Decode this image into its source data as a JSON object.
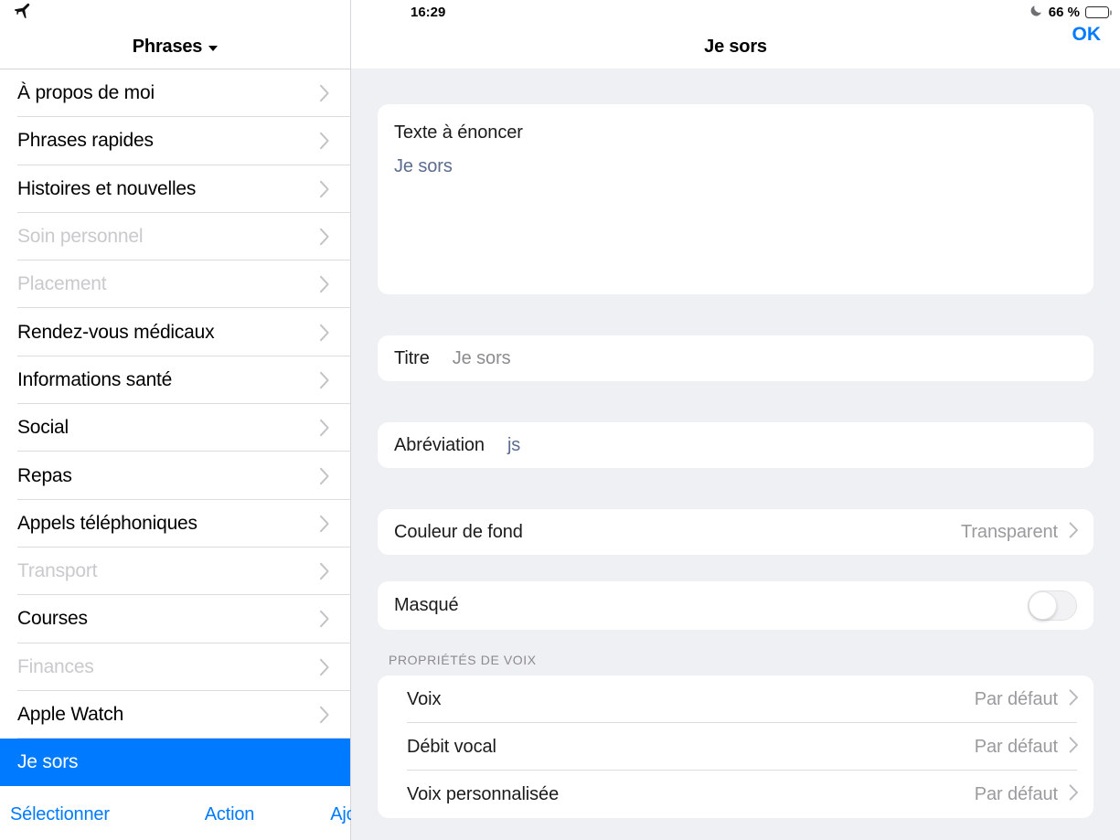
{
  "status_bar": {
    "airplane_icon": "airplane-mode-icon",
    "time": "16:29",
    "dnd_icon": "crescent-moon-icon",
    "battery_label": "66 %",
    "battery_percent": 66
  },
  "sidebar": {
    "header": {
      "title": "Phrases",
      "caret_icon": "chevron-down-icon"
    },
    "items": [
      {
        "label": "À propos de moi",
        "dimmed": false,
        "selected": false,
        "chevron": true
      },
      {
        "label": "Phrases rapides",
        "dimmed": false,
        "selected": false,
        "chevron": true
      },
      {
        "label": "Histoires et nouvelles",
        "dimmed": false,
        "selected": false,
        "chevron": true
      },
      {
        "label": "Soin personnel",
        "dimmed": true,
        "selected": false,
        "chevron": true
      },
      {
        "label": "Placement",
        "dimmed": true,
        "selected": false,
        "chevron": true
      },
      {
        "label": "Rendez-vous médicaux",
        "dimmed": false,
        "selected": false,
        "chevron": true
      },
      {
        "label": "Informations santé",
        "dimmed": false,
        "selected": false,
        "chevron": true
      },
      {
        "label": "Social",
        "dimmed": false,
        "selected": false,
        "chevron": true
      },
      {
        "label": "Repas",
        "dimmed": false,
        "selected": false,
        "chevron": true
      },
      {
        "label": "Appels téléphoniques",
        "dimmed": false,
        "selected": false,
        "chevron": true
      },
      {
        "label": "Transport",
        "dimmed": true,
        "selected": false,
        "chevron": true
      },
      {
        "label": "Courses",
        "dimmed": false,
        "selected": false,
        "chevron": true
      },
      {
        "label": "Finances",
        "dimmed": true,
        "selected": false,
        "chevron": true
      },
      {
        "label": "Apple Watch",
        "dimmed": false,
        "selected": false,
        "chevron": true
      },
      {
        "label": "Je sors",
        "dimmed": false,
        "selected": true,
        "chevron": false
      }
    ],
    "toolbar": {
      "select_label": "Sélectionner",
      "action_label": "Action",
      "add_label": "Ajouter"
    }
  },
  "detail": {
    "title": "Je sors",
    "done_label": "OK",
    "speak_text": {
      "label": "Texte à énoncer",
      "value": "Je sors"
    },
    "fields": [
      {
        "label": "Titre",
        "value": "Je sors",
        "value_style": "gray"
      },
      {
        "label": "Abréviation",
        "value": "js",
        "value_style": "blue"
      }
    ],
    "background_color": {
      "label": "Couleur de fond",
      "value": "Transparent",
      "chevron_icon": "chevron-right-icon"
    },
    "hidden_toggle": {
      "label": "Masqué",
      "state": "off"
    },
    "voice_section": {
      "header": "PROPRIÉTÉS DE VOIX",
      "rows": [
        {
          "label": "Voix",
          "value": "Par défaut",
          "chevron_icon": "chevron-right-icon"
        },
        {
          "label": "Débit vocal",
          "value": "Par défaut",
          "chevron_icon": "chevron-right-icon"
        },
        {
          "label": "Voix personnalisée",
          "value": "Par défaut",
          "chevron_icon": "chevron-right-icon"
        }
      ]
    }
  },
  "colors": {
    "accent_blue": "#007aff",
    "selected_row_blue": "#007aff",
    "pane_background": "#eff0f4",
    "card_white": "#ffffff",
    "dim_text": "#c9c9ce",
    "muted_value": "#9a9a9f",
    "slate_blue_value": "#5c6c8e"
  }
}
